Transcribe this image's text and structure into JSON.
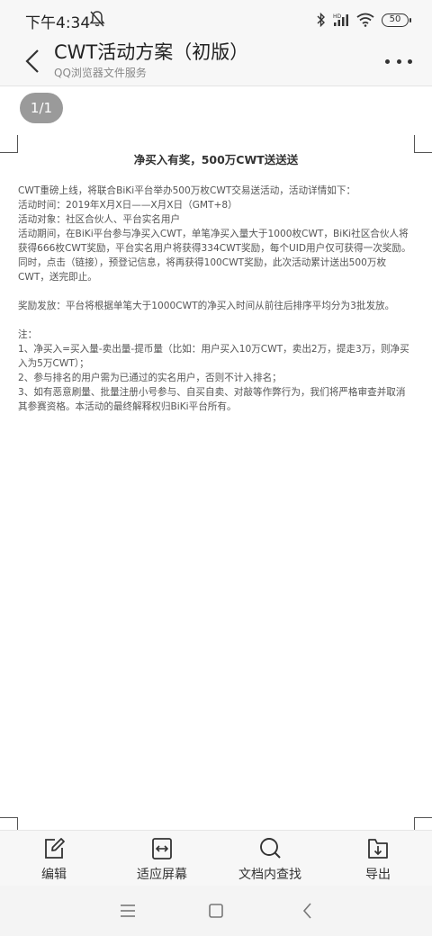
{
  "status_bar": {
    "time": "下午4:34",
    "battery": "50",
    "icons": [
      "mute-icon",
      "bluetooth-icon",
      "signal-icon",
      "wifi-icon",
      "battery-icon"
    ]
  },
  "header": {
    "title": "CWT活动方案（初版）",
    "subtitle": "QQ浏览器文件服务"
  },
  "page_indicator": "1/1",
  "document": {
    "heading": "净买入有奖，500万CWT送送送",
    "paragraphs": [
      "CWT重磅上线，将联合BiKi平台举办500万枚CWT交易送活动，活动详情如下：",
      "活动时间：2019年X月X日——X月X日（GMT+8）",
      "活动对象：社区合伙人、平台实名用户",
      "活动期间，在BiKi平台参与净买入CWT，单笔净买入量大于1000枚CWT，BiKi社区合伙人将获得666枚CWT奖励，平台实名用户将获得334CWT奖励，每个UID用户仅可获得一次奖励。同时，点击（链接），预登记信息，将再获得100CWT奖励，此次活动累计送出500万枚CWT，送完即止。",
      "",
      "奖励发放：平台将根据单笔大于1000CWT的净买入时间从前往后排序平均分为3批发放。",
      "",
      "注：",
      "1、净买入=买入量-卖出量-提币量（比如：用户买入10万CWT，卖出2万，提走3万，则净买入为5万CWT）；",
      "2、参与排名的用户需为已通过的实名用户，否则不计入排名；",
      "3、如有恶意刷量、批量注册小号参与、自买自卖、对敲等作弊行为，我们将严格审查并取消其参赛资格。本活动的最终解释权归BiKi平台所有。"
    ]
  },
  "toolbar": {
    "edit": "编辑",
    "fit_screen": "适应屏幕",
    "find_in_doc": "文档内查找",
    "export": "导出"
  },
  "nav": [
    "menu-icon",
    "home-icon",
    "back-icon"
  ]
}
